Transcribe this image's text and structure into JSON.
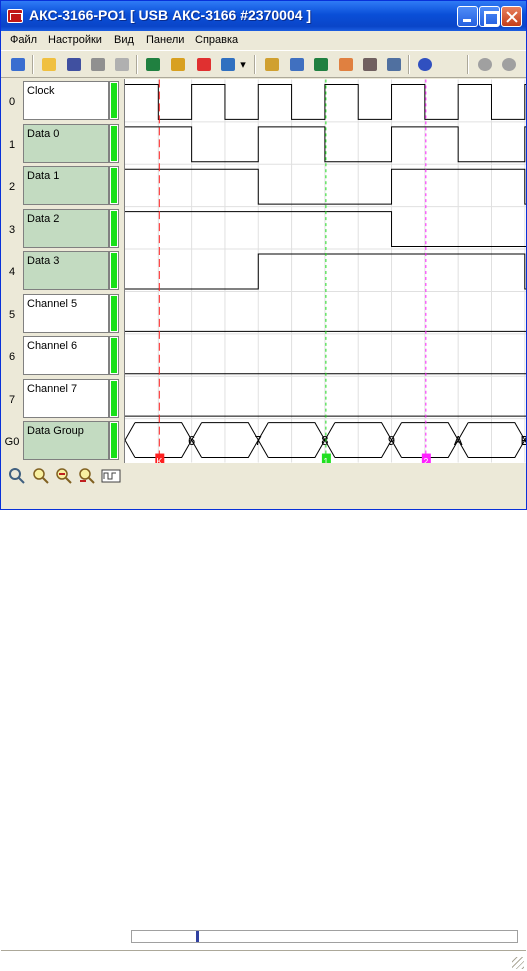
{
  "window": {
    "title": "АКС-3166-PO1 [ USB АКС-3166 #2370004 ]"
  },
  "menu": [
    "Файл",
    "Настройки",
    "Вид",
    "Панели",
    "Справка"
  ],
  "toolbar": {
    "icons": [
      "exit-icon",
      "open-icon",
      "save-icon",
      "tape-icon",
      "print-icon",
      "run-icon",
      "trigger-icon",
      "clear-icon",
      "connect-icon",
      "settings-icon",
      "grid-icon",
      "delete-icon",
      "cursor-icon",
      "measure-icon",
      "probe-icon",
      "info-icon",
      "zoom-in-icon",
      "zoom-out-icon"
    ]
  },
  "channels": [
    {
      "index": "0",
      "name": "Clock",
      "style": "white"
    },
    {
      "index": "1",
      "name": "Data 0",
      "style": "green"
    },
    {
      "index": "2",
      "name": "Data 1",
      "style": "green"
    },
    {
      "index": "3",
      "name": "Data 2",
      "style": "green"
    },
    {
      "index": "4",
      "name": "Data 3",
      "style": "green"
    },
    {
      "index": "5",
      "name": "Channel 5",
      "style": "white"
    },
    {
      "index": "6",
      "name": "Channel 6",
      "style": "white"
    },
    {
      "index": "7",
      "name": "Channel 7",
      "style": "white"
    },
    {
      "index": "G0",
      "name": "Data Group",
      "style": "green"
    }
  ],
  "waveforms": {
    "Clock": "1010101010101",
    "Data 0": "1100110011001",
    "Data 1": "1111000011110",
    "Data 2": "1111111100000",
    "Data 3": "0000111111110",
    "Channel 5": "0000000000000",
    "Channel 6": "0000000000000",
    "Channel 7": "0000000000000"
  },
  "group_values": [
    "6",
    "7",
    "8",
    "9",
    "A",
    "B"
  ],
  "markers": [
    {
      "label": "K",
      "color": "#ff2020"
    },
    {
      "label": "1",
      "color": "#20e020"
    },
    {
      "label": "2",
      "color": "#ff20ff"
    }
  ],
  "colors": {
    "active_channel": "#18e018",
    "label_green": "#c3dbc1",
    "grid": "#e0e0e0"
  }
}
